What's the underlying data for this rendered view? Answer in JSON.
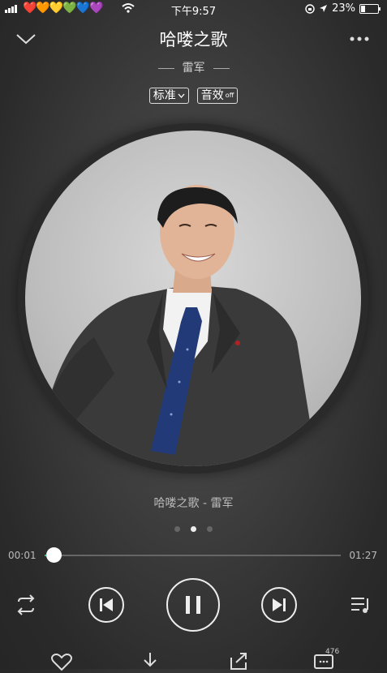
{
  "status_bar": {
    "emoji_hearts": "❤️🧡💛💚💙💜",
    "time": "下午9:57",
    "battery_percent": "23%",
    "battery_level": 0.23
  },
  "header": {
    "song_title": "哈喽之歌",
    "artist": "雷军",
    "quality_label": "标准",
    "effect_label": "音效",
    "effect_state": "off"
  },
  "player": {
    "caption": "哈喽之歌 - 雷军",
    "current_time": "00:01",
    "total_time": "01:27",
    "progress": 0.02,
    "page_dots": 3,
    "active_dot": 1
  },
  "actions": {
    "comment_count": "476"
  },
  "icons": [
    "chevron-down-icon",
    "more-icon",
    "repeat-icon",
    "prev-icon",
    "pause-icon",
    "next-icon",
    "playlist-icon",
    "heart-icon",
    "download-icon",
    "share-icon",
    "comment-icon"
  ]
}
